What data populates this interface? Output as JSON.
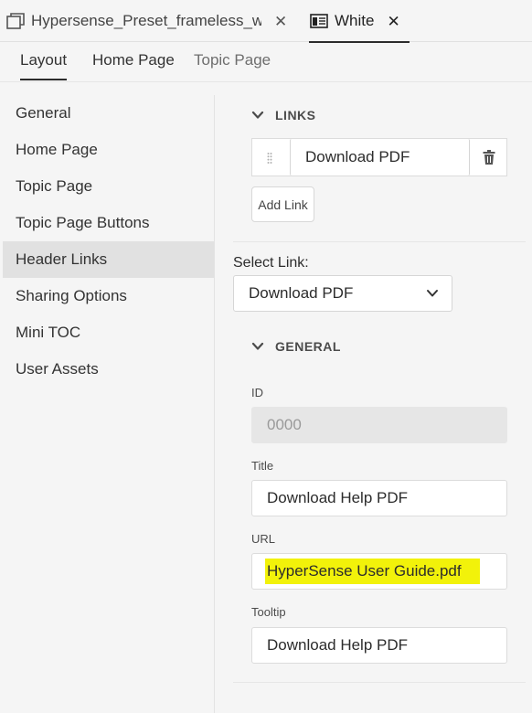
{
  "doc_tabs": [
    {
      "label": "Hypersense_Preset_frameless_w...",
      "icon": "window-icon",
      "close": "✕"
    },
    {
      "label": "White",
      "icon": "layout-icon",
      "close": "✕"
    }
  ],
  "sub_tabs": [
    "Layout",
    "Home Page",
    "Topic Page"
  ],
  "nav_items": [
    "General",
    "Home Page",
    "Topic Page",
    "Topic Page Buttons",
    "Header Links",
    "Sharing Options",
    "Mini TOC",
    "User Assets"
  ],
  "nav_selected": "Header Links",
  "links_section": {
    "title": "LINKS",
    "link_value": "Download PDF",
    "add_link_label": "Add Link"
  },
  "select_link": {
    "label": "Select Link:",
    "value": "Download PDF"
  },
  "general_section": {
    "title": "GENERAL",
    "id_label": "ID",
    "id_value": "0000",
    "title_label": "Title",
    "title_value": "Download Help PDF",
    "url_label": "URL",
    "url_value": "HyperSense User Guide.pdf",
    "tooltip_label": "Tooltip",
    "tooltip_value": "Download Help PDF"
  },
  "colors": {
    "highlight": "#f2f20a",
    "selected_nav": "#e1e1e1",
    "background": "#f5f5f5"
  }
}
